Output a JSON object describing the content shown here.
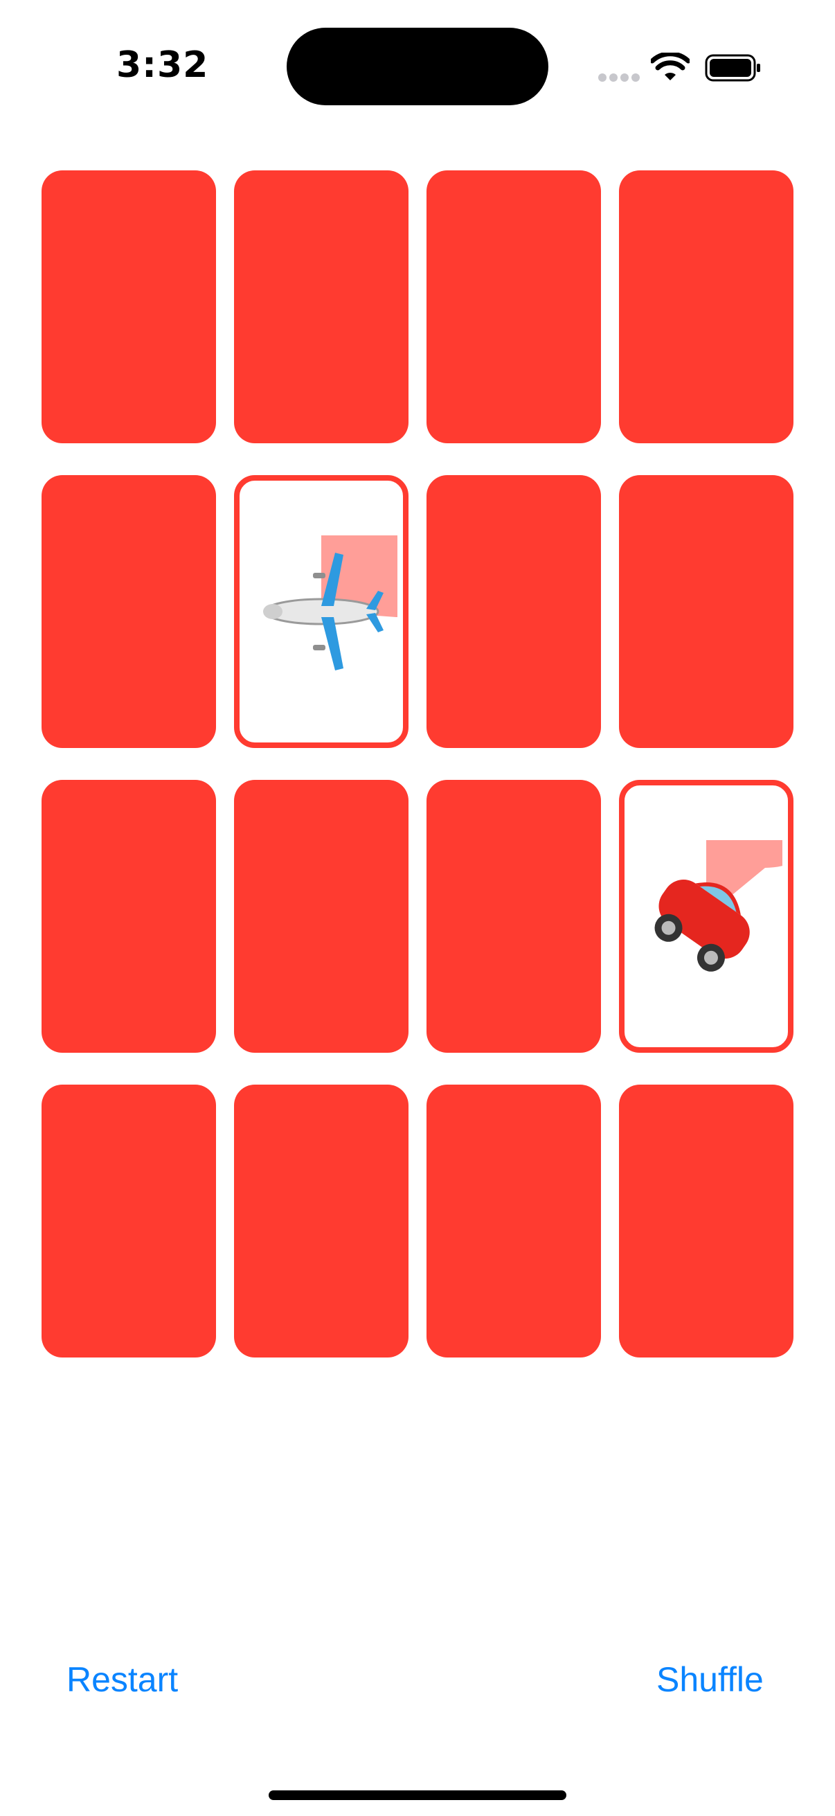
{
  "status_bar": {
    "time": "3:32"
  },
  "cards": [
    {
      "state": "face-down"
    },
    {
      "state": "face-down"
    },
    {
      "state": "face-down"
    },
    {
      "state": "face-down"
    },
    {
      "state": "face-down"
    },
    {
      "state": "face-up",
      "emoji": "airplane-emoji"
    },
    {
      "state": "face-down"
    },
    {
      "state": "face-down"
    },
    {
      "state": "face-down"
    },
    {
      "state": "face-down"
    },
    {
      "state": "face-down"
    },
    {
      "state": "face-up",
      "emoji": "car-emoji"
    },
    {
      "state": "face-down"
    },
    {
      "state": "face-down"
    },
    {
      "state": "face-down"
    },
    {
      "state": "face-down"
    }
  ],
  "colors": {
    "card_back": "#ff3b30",
    "pie_timer": "#ff9e98",
    "accent": "#0a84ff"
  },
  "toolbar": {
    "restart_label": "Restart",
    "shuffle_label": "Shuffle"
  }
}
